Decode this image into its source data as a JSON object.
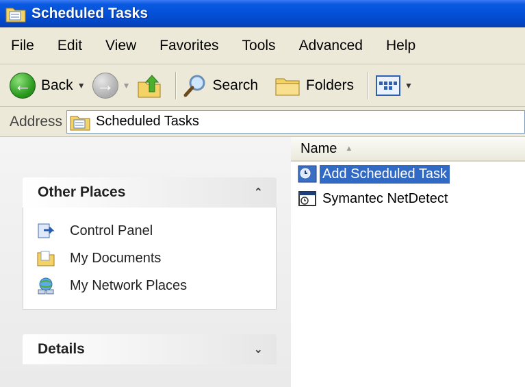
{
  "window": {
    "title": "Scheduled Tasks"
  },
  "menu": [
    "File",
    "Edit",
    "View",
    "Favorites",
    "Tools",
    "Advanced",
    "Help"
  ],
  "toolbar": {
    "back_label": "Back",
    "search_label": "Search",
    "folders_label": "Folders"
  },
  "address": {
    "label": "Address",
    "value": "Scheduled Tasks"
  },
  "other_places": {
    "title": "Other Places",
    "items": [
      {
        "label": "Control Panel",
        "icon": "control-panel-icon"
      },
      {
        "label": "My Documents",
        "icon": "my-documents-icon"
      },
      {
        "label": "My Network Places",
        "icon": "network-places-icon"
      }
    ]
  },
  "details": {
    "title": "Details"
  },
  "file_list": {
    "column_name": "Name",
    "files": [
      {
        "name": "Add Scheduled Task",
        "selected": true
      },
      {
        "name": "Symantec NetDetect",
        "selected": false
      }
    ]
  },
  "colors": {
    "titlebar": "#0450d8",
    "selection": "#316ac5",
    "chrome": "#ece9d8"
  }
}
